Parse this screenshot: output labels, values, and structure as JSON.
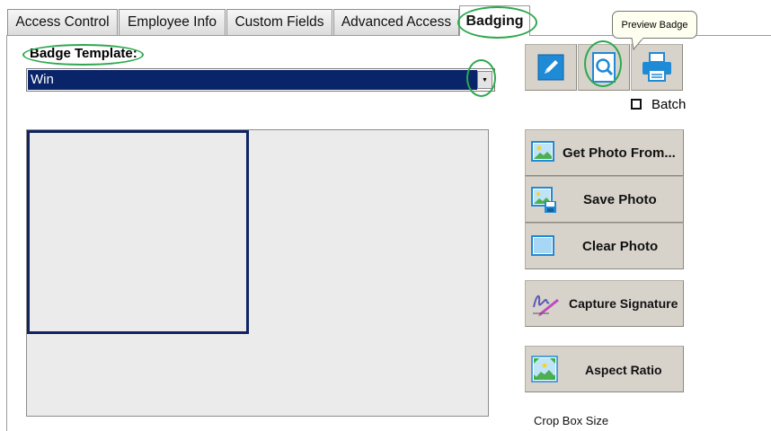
{
  "tabs": [
    {
      "label": "Access Control"
    },
    {
      "label": "Employee Info"
    },
    {
      "label": "Custom Fields"
    },
    {
      "label": "Advanced Access"
    },
    {
      "label": "Badging"
    }
  ],
  "active_tab": "Badging",
  "badge_template": {
    "label": "Badge Template:",
    "value": "Win"
  },
  "toolbar": {
    "edit_icon": "pencil-icon",
    "preview_icon": "magnifier-icon",
    "print_icon": "printer-icon",
    "tooltip": "Preview Badge"
  },
  "batch": {
    "label": "Batch",
    "checked": false
  },
  "actions": {
    "get_photo": "Get Photo From...",
    "save_photo": "Save Photo",
    "clear_photo": "Clear Photo",
    "capture_signature": "Capture Signature",
    "aspect_ratio": "Aspect Ratio"
  },
  "crop_box_size_label": "Crop Box Size",
  "colors": {
    "highlight_ring": "#2fa84f",
    "selection": "#0a246a",
    "crop_box_border": "#0f2461",
    "icon_blue": "#1f8ad6"
  }
}
